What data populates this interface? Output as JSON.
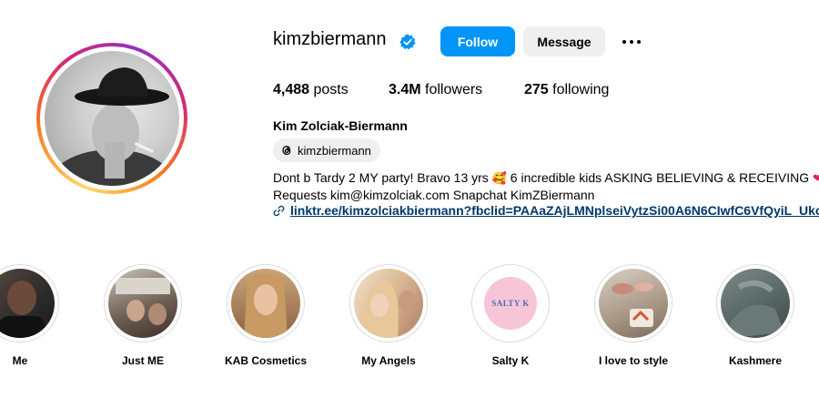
{
  "profile": {
    "username": "kimzbiermann",
    "follow_label": "Follow",
    "message_label": "Message",
    "stats": {
      "posts_count": "4,488",
      "posts_label": "posts",
      "followers_count": "3.4M",
      "followers_label": "followers",
      "following_count": "275",
      "following_label": "following"
    },
    "full_name": "Kim Zolciak-Biermann",
    "threads_handle": "kimzbiermann",
    "bio_line1_a": "Dont b Tardy 2 MY party! Bravo 13 yrs",
    "bio_line1_b": "6 incredible kids ASKING BELIEVING & RECEIVING",
    "bio_line2": "Requests kim@kimzolciak.com Snapchat KimZBiermann",
    "link": "linktr.ee/kimzolciakbiermann?fbclid=PAAaZAjLMNplseiVytzSi00A6N6CIwfC6VfQyiL_Ukoin"
  },
  "highlights": [
    {
      "label": "Me"
    },
    {
      "label": "Just ME"
    },
    {
      "label": "KAB Cosmetics"
    },
    {
      "label": "My Angels"
    },
    {
      "label": "Salty K",
      "cover_text": "SALTY K"
    },
    {
      "label": "I love to style"
    },
    {
      "label": "Kashmere"
    }
  ],
  "icons": {
    "verified": "verified-badge-icon",
    "threads": "threads-icon",
    "link": "link-icon",
    "more": "more-options-icon"
  },
  "colors": {
    "accent": "#0095f6",
    "link": "#00376b",
    "button_secondary": "#efefef"
  }
}
